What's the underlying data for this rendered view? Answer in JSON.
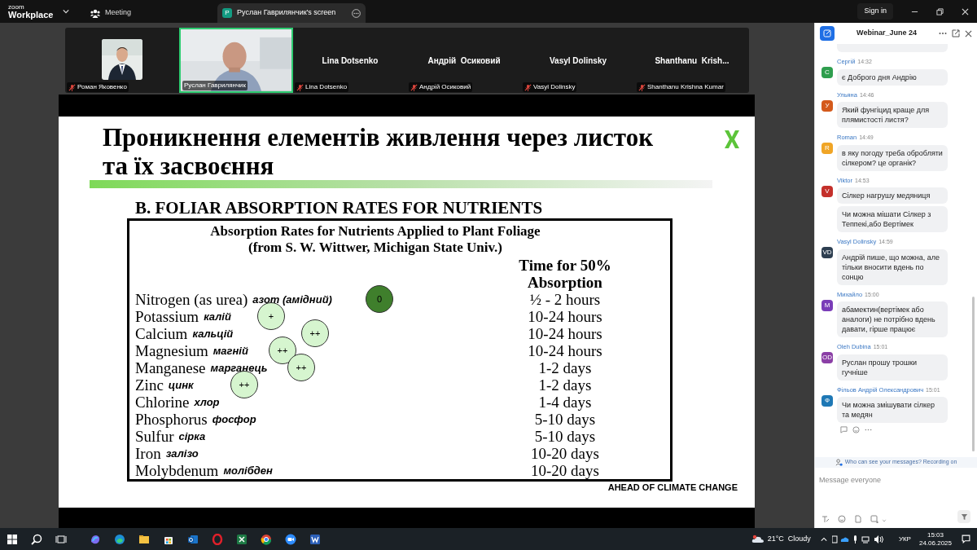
{
  "app": {
    "logo_top": "zoom",
    "logo_bottom": "Workplace"
  },
  "top_tabs": [
    {
      "kind": "meeting",
      "label": "Meeting",
      "selected": false
    },
    {
      "kind": "share",
      "label": "Руслан Гаврилянчик's screen",
      "avatar": "P",
      "selected": true
    }
  ],
  "sign_in": "Sign in",
  "participants": [
    {
      "label": "Роман Яковенко",
      "muted": true,
      "speaking": false
    },
    {
      "kind": "video",
      "label": "Руслан Гаврилянчик",
      "muted": false,
      "speaking": true
    },
    {
      "kind": "name",
      "display": "Lina Dotsenko",
      "label": "Lina Dotsenko",
      "muted": true,
      "speaking": false
    },
    {
      "kind": "name",
      "display": "Андрій  Осиковий",
      "label": "Андрій Осиковий",
      "muted": true,
      "speaking": false
    },
    {
      "kind": "name",
      "display": "Vasyl Dolinsky",
      "label": "Vasyl Dolinsky",
      "muted": true,
      "speaking": false
    },
    {
      "kind": "name",
      "display": "Shanthanu  Krish...",
      "label": "Shanthanu Krishna Kumar",
      "muted": true,
      "speaking": false
    }
  ],
  "slide": {
    "title_lines": [
      "Проникнення елементів живлення через листок",
      "та їх засвоєння"
    ],
    "subtitle": "B. FOLIAR ABSORPTION RATES FOR NUTRIENTS",
    "table_title_lines": [
      "Absorption Rates for Nutrients Applied to Plant Foliage",
      "(from S. W. Wittwer, Michigan State Univ.)"
    ],
    "time_header_lines": [
      "Time for 50%",
      "Absorption"
    ],
    "rows": [
      {
        "nutrient": "Nitrogen (as urea)",
        "note": "азот (амідний)",
        "time": "½ - 2 hours",
        "mark": "0",
        "color": "#3f7f2c"
      },
      {
        "nutrient": "Potassium",
        "note": "калій",
        "time": "10-24 hours",
        "mark": "+",
        "color": "#d6f5cf"
      },
      {
        "nutrient": "Calcium",
        "note": "кальцій",
        "time": "10-24 hours",
        "mark": "++",
        "color": "#d6f5cf"
      },
      {
        "nutrient": "Magnesium",
        "note": "магній",
        "time": "10-24 hours",
        "mark": "++",
        "color": "#d6f5cf"
      },
      {
        "nutrient": "Manganese",
        "note": "марганець",
        "time": "1-2 days",
        "mark": "++",
        "color": "#d6f5cf"
      },
      {
        "nutrient": "Zinc",
        "note": "цинк",
        "time": "1-2 days",
        "mark": "++",
        "color": "#d6f5cf"
      },
      {
        "nutrient": "Chlorine",
        "note": "хлор",
        "time": "1-4 days"
      },
      {
        "nutrient": "Phosphorus",
        "note": "фосфор",
        "time": "5-10 days"
      },
      {
        "nutrient": "Sulfur",
        "note": "сірка",
        "time": "5-10 days"
      },
      {
        "nutrient": "Iron",
        "note": "залізо",
        "time": "10-20 days"
      },
      {
        "nutrient": "Molybdenum",
        "note": "молібден",
        "time": "10-20 days"
      }
    ],
    "footer": "AHEAD OF CLIMATE CHANGE"
  },
  "chat": {
    "title": "Webinar_June 24",
    "messages": [
      {
        "author": "Сергій",
        "time": "14:32",
        "avatar": "С",
        "color": "#2f9e4e",
        "texts": [
          "є  Доброго дня  Андрію"
        ]
      },
      {
        "author": "Ульяна",
        "time": "14:46",
        "avatar": "У",
        "color": "#d45a1c",
        "texts": [
          "Який фунгіцид краще для плямистості листя?"
        ]
      },
      {
        "author": "Roman",
        "time": "14:49",
        "avatar": "R",
        "color": "#f0a526",
        "texts": [
          "в яку погоду треба обробляти сілкером? це органік?"
        ]
      },
      {
        "author": "Viktor",
        "time": "14:53",
        "avatar": "V",
        "color": "#c4302b",
        "texts": [
          "Сілкер нагрушу медяниця",
          "Чи можна мішати Сілкер з Теппекі,або Вертімек"
        ]
      },
      {
        "author": "Vasyl Dolinsky",
        "time": "14:59",
        "avatar": "VD",
        "color": "#2d3e50",
        "texts": [
          "Андрій пише, що можна, але  тільки вносити вдень по сонцю"
        ]
      },
      {
        "author": "Михайло",
        "time": "15:00",
        "avatar": "M",
        "color": "#7a3db8",
        "texts": [
          "абамектин(вертімек або аналоги) не потрібно вдень давати, гірше працює"
        ]
      },
      {
        "author": "Oleh Dubina",
        "time": "15:01",
        "avatar": "OD",
        "color": "#8b3fa6",
        "texts": [
          "Руслан прошу трошки гучніше"
        ]
      },
      {
        "author": "Фільов Андрій Олександрович",
        "time": "15:01",
        "avatar": "Ф",
        "color": "#1e78b5",
        "texts": [
          "Чи можна змішувати сілкер та медян"
        ]
      }
    ],
    "notice": "Who can see your messages? Recording on",
    "placeholder": "Message everyone"
  },
  "taskbar": {
    "weather": "21°C  Cloudy",
    "language": "УКР",
    "time": "15:03",
    "date": "24.06.2025"
  }
}
